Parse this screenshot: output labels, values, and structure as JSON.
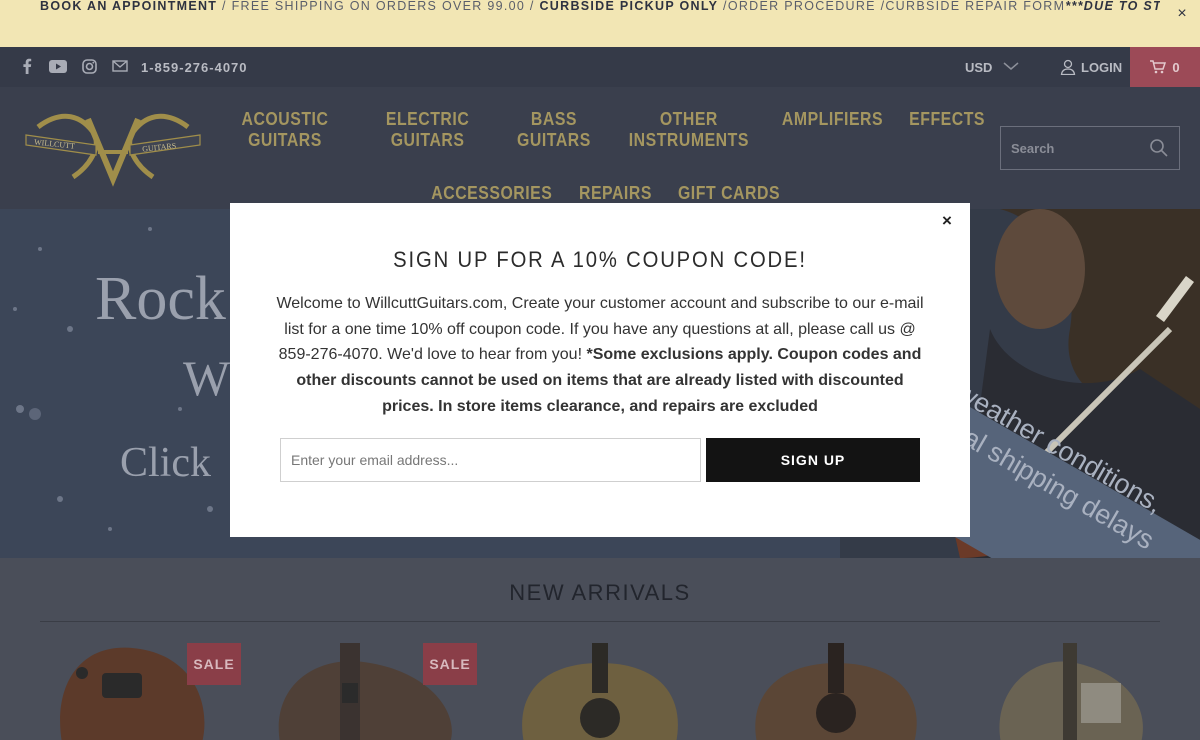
{
  "announcement": {
    "book": "BOOK AN APPOINTMENT",
    "shipping": " / FREE SHIPPING ON ORDERS OVER 99.00 / ",
    "pickup": "CURBSIDE PICKUP ONLY",
    "links": " /ORDER PROCEDURE /CURBSIDE REPAIR FORM",
    "storm": "***DUE TO STORM, SHIPPING DELAYS ARE POSSIBLE***",
    "close": "×"
  },
  "topbar": {
    "phone": "1-859-276-4070",
    "currency": "USD",
    "login": "LOGIN",
    "cart_count": "0"
  },
  "logo": {
    "left_text": "WILLCUTT",
    "right_text": "GUITARS"
  },
  "nav": {
    "row1": [
      "ACOUSTIC GUITARS",
      "ELECTRIC GUITARS",
      "BASS GUITARS",
      "OTHER INSTRUMENTS",
      "AMPLIFIERS",
      "EFFECTS"
    ],
    "row2": [
      "ACCESSORIES",
      "REPAIRS",
      "GIFT CARDS"
    ]
  },
  "search": {
    "placeholder": "Search"
  },
  "hero": {
    "line1": "Rock",
    "line2": "W",
    "line3": "Click",
    "banner_line1": "weather conditions,",
    "banner_line2": "ntial shipping delays"
  },
  "arrivals": {
    "title": "NEW ARRIVALS",
    "sale_label": "SALE"
  },
  "modal": {
    "close": "×",
    "title": "SIGN UP FOR A 10% COUPON CODE!",
    "body_normal": "Welcome to WillcuttGuitars.com, Create your customer account and subscribe to our e-mail list for a one time 10% off coupon code. If you have any questions at all, please call us @ 859-276-4070.  We'd love to hear from you! ",
    "body_bold": "*Some exclusions apply. Coupon codes and other discounts cannot be used on items that are already listed with discounted prices. In store items clearance, and repairs are excluded",
    "email_placeholder": "Enter your email address...",
    "signup_label": "SIGN UP"
  },
  "colors": {
    "announcement_bg": "#f2e6b4",
    "nav_text": "#a49660",
    "cart_bg": "#9c4a57",
    "button_bg": "#131313"
  }
}
